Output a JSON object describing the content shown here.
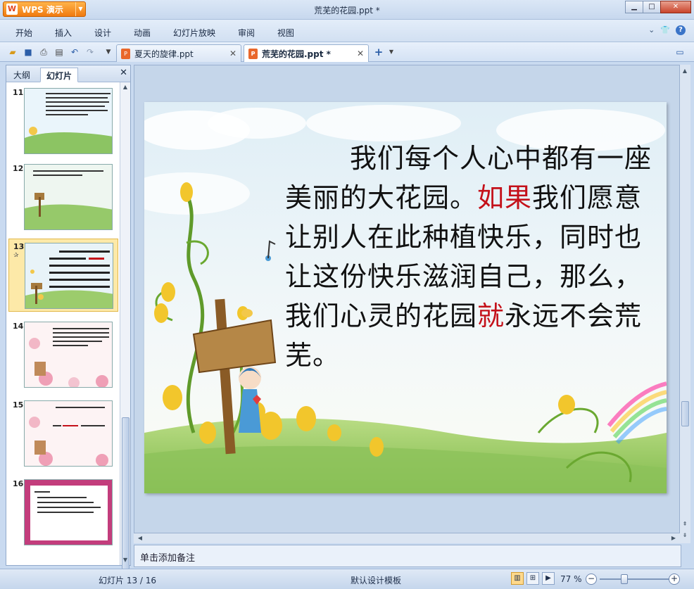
{
  "app": {
    "brand": "WPS 演示",
    "window_title": "荒芜的花园.ppt *",
    "controls": {
      "minimize": "▁",
      "maximize": "□",
      "close": "✕"
    }
  },
  "menu": {
    "items": [
      "开始",
      "插入",
      "设计",
      "动画",
      "幻灯片放映",
      "审阅",
      "视图"
    ]
  },
  "tabs": [
    {
      "label": "夏天的旋律.ppt",
      "active": false
    },
    {
      "label": "荒芜的花园.ppt *",
      "active": true
    }
  ],
  "panel": {
    "tab_outline": "大纲",
    "tab_slides": "幻灯片",
    "thumbnails": [
      {
        "num": "11",
        "text": "儿时，有人在此种花草，有的种花有的种果，有的种上了小草……"
      },
      {
        "num": "12",
        "text": "在荒芜的花园里，我们看到了什么……"
      },
      {
        "num": "13",
        "text": "我们每个人心中都有一座美丽的大花园。如果我们愿意让别人在此种植快乐……",
        "selected": true,
        "sub": "✰"
      },
      {
        "num": "14",
        "text": "在大家一起分享了本来属于我们的快乐……"
      },
      {
        "num": "15",
        "text": "你知道什么是…"
      },
      {
        "num": "16",
        "text": "作业：1. 把你对花园的理解写下来。2. …"
      }
    ]
  },
  "slide": {
    "text_before": "我们每个人心中都有一座美丽的大花园。",
    "red1": "如果",
    "text_mid": "我们愿意让别人在此种植快乐，同时也让这份快乐滋润自己，那么，我们心灵的花园",
    "red2": "就",
    "text_after": "永远不会荒芜。"
  },
  "notes": {
    "placeholder": "单击添加备注"
  },
  "status": {
    "slide_counter": "幻灯片 13 / 16",
    "template": "默认设计模板",
    "zoom": "77 %"
  },
  "colors": {
    "accent": "#f07a10",
    "highlight_red": "#c4111a"
  }
}
